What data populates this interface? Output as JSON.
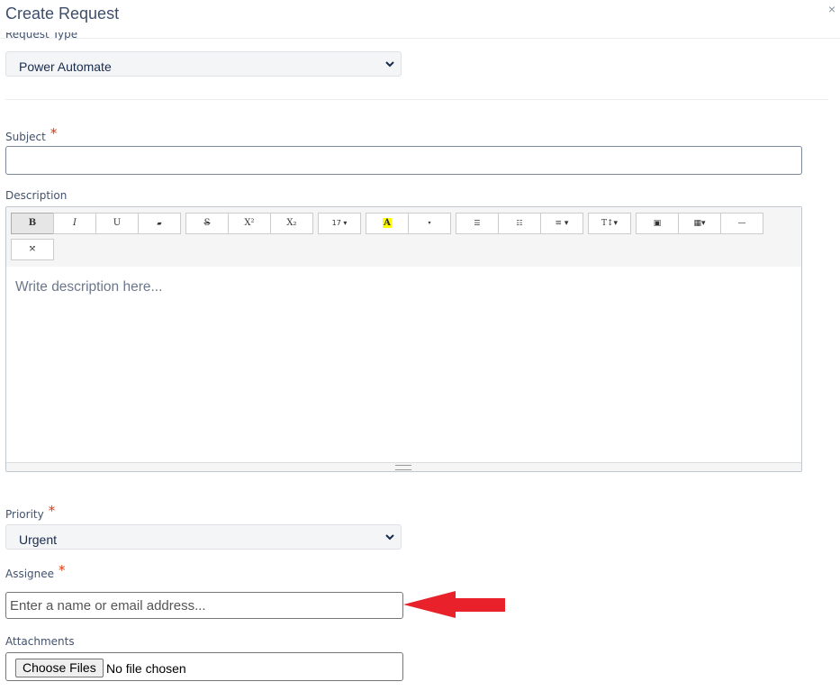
{
  "dialog": {
    "title": "Create Request",
    "close_glyph": "×"
  },
  "request_type": {
    "label": "Request Type",
    "value": "Power Automate"
  },
  "subject": {
    "label": "Subject",
    "required_mark": "*",
    "value": ""
  },
  "description": {
    "label": "Description",
    "placeholder": "Write description here...",
    "toolbar": {
      "bold": "B",
      "italic": "I",
      "underline": "U",
      "clear_format": "▰",
      "strikethrough": "S",
      "superscript": "X²",
      "subscript": "X₂",
      "font_size": "17 ▾",
      "color": "A",
      "color_more": "▾",
      "unordered_list": "☰",
      "ordered_list": "☷",
      "align": "≡ ▾",
      "style": "T↕▾",
      "picture": "▣",
      "table": "▦▾",
      "hr": "—",
      "fullscreen": "⤧"
    }
  },
  "priority": {
    "label": "Priority",
    "required_mark": "*",
    "value": "Urgent"
  },
  "assignee": {
    "label": "Assignee",
    "required_mark": "*",
    "placeholder": "Enter a name or email address..."
  },
  "attachments": {
    "label": "Attachments",
    "button": "Choose Files",
    "status": "No file chosen"
  },
  "colors": {
    "required": "#de350b",
    "arrow": "#e8212a",
    "title": "#3d4d6b"
  }
}
